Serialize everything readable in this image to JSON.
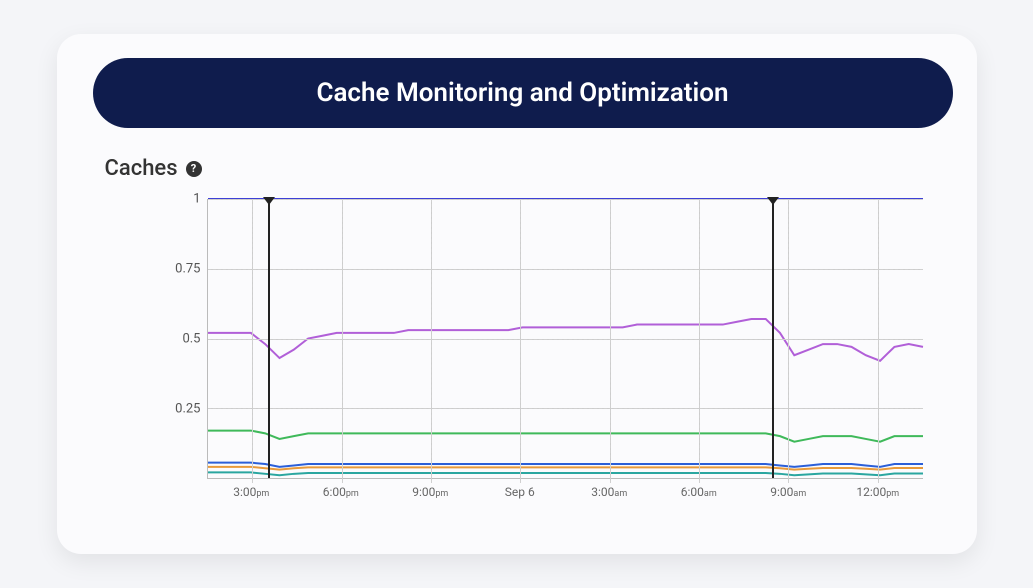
{
  "title": "Cache Monitoring and Optimization",
  "section_title": "Caches",
  "help_glyph": "?",
  "chart_data": {
    "type": "line",
    "ylim": [
      0,
      1
    ],
    "yticks": [
      0.25,
      0.5,
      0.75,
      1
    ],
    "xticks": [
      "3:00pm",
      "6:00pm",
      "9:00pm",
      "Sep 6",
      "3:00am",
      "6:00am",
      "9:00am",
      "12:00pm"
    ],
    "event_markers_x": [
      0.085,
      0.79
    ],
    "series": [
      {
        "name": "indigo",
        "color": "#3d3fd6",
        "values": [
          1.0,
          1.0,
          1.0,
          1.0,
          1.0,
          1.0,
          1.0,
          1.0,
          1.0,
          1.0,
          1.0,
          1.0,
          1.0,
          1.0,
          1.0,
          1.0,
          1.0,
          1.0,
          1.0,
          1.0,
          1.0,
          1.0,
          1.0,
          1.0,
          1.0,
          1.0,
          1.0,
          1.0,
          1.0,
          1.0,
          1.0,
          1.0,
          1.0,
          1.0,
          1.0,
          1.0,
          1.0,
          1.0,
          1.0,
          1.0,
          1.0,
          1.0,
          1.0,
          1.0,
          1.0,
          1.0,
          1.0,
          1.0,
          1.0,
          1.0,
          1.0
        ]
      },
      {
        "name": "purple",
        "color": "#b15fd8",
        "values": [
          0.52,
          0.52,
          0.52,
          0.52,
          0.48,
          0.43,
          0.46,
          0.5,
          0.51,
          0.52,
          0.52,
          0.52,
          0.52,
          0.52,
          0.53,
          0.53,
          0.53,
          0.53,
          0.53,
          0.53,
          0.53,
          0.53,
          0.54,
          0.54,
          0.54,
          0.54,
          0.54,
          0.54,
          0.54,
          0.54,
          0.55,
          0.55,
          0.55,
          0.55,
          0.55,
          0.55,
          0.55,
          0.56,
          0.57,
          0.57,
          0.52,
          0.44,
          0.46,
          0.48,
          0.48,
          0.47,
          0.44,
          0.42,
          0.47,
          0.48,
          0.47
        ]
      },
      {
        "name": "green",
        "color": "#3fb95a",
        "values": [
          0.17,
          0.17,
          0.17,
          0.17,
          0.16,
          0.14,
          0.15,
          0.16,
          0.16,
          0.16,
          0.16,
          0.16,
          0.16,
          0.16,
          0.16,
          0.16,
          0.16,
          0.16,
          0.16,
          0.16,
          0.16,
          0.16,
          0.16,
          0.16,
          0.16,
          0.16,
          0.16,
          0.16,
          0.16,
          0.16,
          0.16,
          0.16,
          0.16,
          0.16,
          0.16,
          0.16,
          0.16,
          0.16,
          0.16,
          0.16,
          0.15,
          0.13,
          0.14,
          0.15,
          0.15,
          0.15,
          0.14,
          0.13,
          0.15,
          0.15,
          0.15
        ]
      },
      {
        "name": "blue",
        "color": "#2b5fd8",
        "values": [
          0.055,
          0.055,
          0.055,
          0.055,
          0.05,
          0.04,
          0.045,
          0.05,
          0.05,
          0.05,
          0.05,
          0.05,
          0.05,
          0.05,
          0.05,
          0.05,
          0.05,
          0.05,
          0.05,
          0.05,
          0.05,
          0.05,
          0.05,
          0.05,
          0.05,
          0.05,
          0.05,
          0.05,
          0.05,
          0.05,
          0.05,
          0.05,
          0.05,
          0.05,
          0.05,
          0.05,
          0.05,
          0.05,
          0.05,
          0.05,
          0.045,
          0.04,
          0.045,
          0.05,
          0.05,
          0.05,
          0.045,
          0.04,
          0.05,
          0.05,
          0.05
        ]
      },
      {
        "name": "orange",
        "color": "#e89a3a",
        "values": [
          0.04,
          0.04,
          0.04,
          0.04,
          0.035,
          0.03,
          0.035,
          0.038,
          0.038,
          0.038,
          0.038,
          0.038,
          0.038,
          0.038,
          0.038,
          0.038,
          0.038,
          0.038,
          0.038,
          0.038,
          0.038,
          0.038,
          0.038,
          0.038,
          0.038,
          0.038,
          0.038,
          0.038,
          0.038,
          0.038,
          0.038,
          0.038,
          0.038,
          0.038,
          0.038,
          0.038,
          0.038,
          0.038,
          0.038,
          0.038,
          0.035,
          0.03,
          0.033,
          0.036,
          0.036,
          0.036,
          0.033,
          0.03,
          0.036,
          0.036,
          0.036
        ]
      },
      {
        "name": "teal",
        "color": "#2aa6a0",
        "values": [
          0.02,
          0.02,
          0.02,
          0.02,
          0.015,
          0.01,
          0.015,
          0.018,
          0.018,
          0.018,
          0.018,
          0.018,
          0.018,
          0.018,
          0.018,
          0.018,
          0.018,
          0.018,
          0.018,
          0.018,
          0.018,
          0.018,
          0.018,
          0.018,
          0.018,
          0.018,
          0.018,
          0.018,
          0.018,
          0.018,
          0.018,
          0.018,
          0.018,
          0.018,
          0.018,
          0.018,
          0.018,
          0.018,
          0.018,
          0.018,
          0.015,
          0.01,
          0.013,
          0.016,
          0.016,
          0.016,
          0.013,
          0.01,
          0.016,
          0.016,
          0.016
        ]
      }
    ]
  }
}
